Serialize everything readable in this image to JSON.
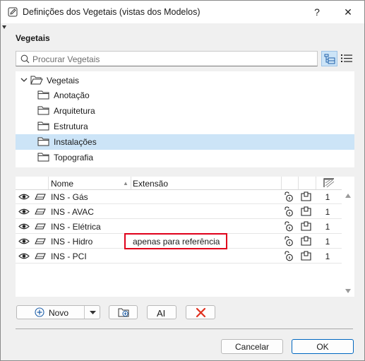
{
  "window": {
    "title": "Definições dos Vegetais (vistas dos Modelos)",
    "help_label": "?",
    "close_label": "✕"
  },
  "section_label": "Vegetais",
  "search": {
    "placeholder": "Procurar Vegetais"
  },
  "tree": {
    "root_label": "Vegetais",
    "items": [
      {
        "label": "Anotação",
        "selected": false
      },
      {
        "label": "Arquitetura",
        "selected": false
      },
      {
        "label": "Estrutura",
        "selected": false
      },
      {
        "label": "Instalações",
        "selected": true
      },
      {
        "label": "Topografia",
        "selected": false
      }
    ]
  },
  "table": {
    "columns": {
      "name": "Nome",
      "extension": "Extensão",
      "sort_indicator": "▲"
    },
    "rows": [
      {
        "name": "INS -  Gás",
        "extension": "",
        "count": "1"
      },
      {
        "name": "INS - AVAC",
        "extension": "",
        "count": "1"
      },
      {
        "name": "INS - Elétrica",
        "extension": "",
        "count": "1"
      },
      {
        "name": "INS - Hidro",
        "extension": "apenas para referência",
        "count": "1"
      },
      {
        "name": "INS - PCI",
        "extension": "",
        "count": "1"
      }
    ]
  },
  "toolbar": {
    "new_label": "Novo",
    "rename_label": "AI"
  },
  "footer": {
    "cancel_label": "Cancelar",
    "ok_label": "OK"
  },
  "colors": {
    "selection": "#cce4f7",
    "highlight_border": "#e0001b",
    "delete_icon": "#e0301e",
    "ok_border": "#0067c0"
  }
}
